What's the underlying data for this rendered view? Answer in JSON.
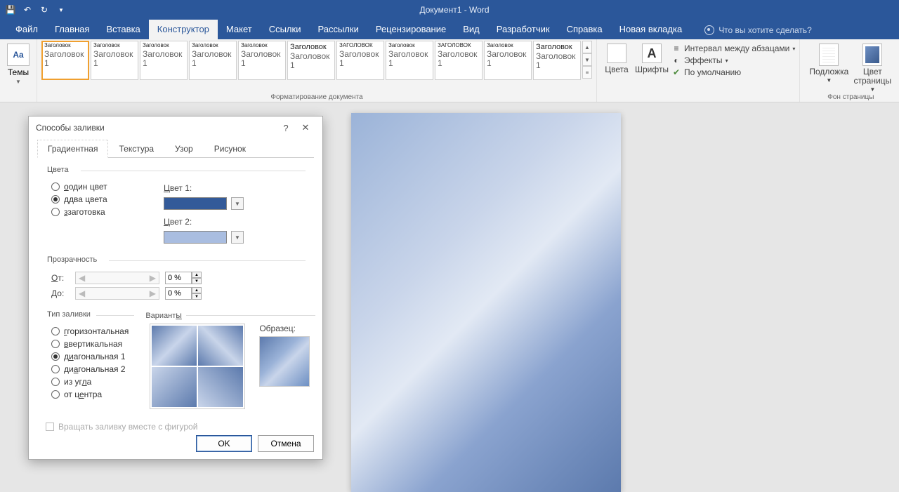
{
  "titlebar": {
    "document_title": "Документ1 - Word"
  },
  "tabs": {
    "file": "Файл",
    "home": "Главная",
    "insert": "Вставка",
    "design": "Конструктор",
    "layout": "Макет",
    "references": "Ссылки",
    "mailings": "Рассылки",
    "review": "Рецензирование",
    "view": "Вид",
    "developer": "Разработчик",
    "help": "Справка",
    "new_tab": "Новая вкладка",
    "tell_me": "Что вы хотите сделать?"
  },
  "ribbon": {
    "themes": "Темы",
    "doc_formatting_label": "Форматирование документа",
    "style_heading_variants": [
      "Заголовок",
      "Заголовок",
      "Заголовок",
      "Заголовок",
      "Заголовок",
      "Заголовок",
      "ЗАГОЛОВОК",
      "Заголовок",
      "ЗАГОЛОВОК",
      "Заголовок",
      "Заголовок"
    ],
    "style_sub": "Заголовок 1",
    "colors": "Цвета",
    "fonts": "Шрифты",
    "para_spacing": "Интервал между абзацами",
    "effects": "Эффекты",
    "set_default": "По умолчанию",
    "watermark": "Подложка",
    "page_color": "Цвет страницы",
    "page_bg_label": "Фон страницы"
  },
  "dialog": {
    "title": "Способы заливки",
    "tabs": {
      "gradient": "Градиентная",
      "texture": "Текстура",
      "pattern": "Узор",
      "picture": "Рисунок"
    },
    "colors_legend": "Цвета",
    "one_color": "один цвет",
    "two_colors": "два цвета",
    "preset": "заготовка",
    "color1_label": "Цвет 1:",
    "color2_label": "Цвет 2:",
    "color1_value": "#335a99",
    "color2_value": "#a9bde0",
    "transparency_legend": "Прозрачность",
    "from_label": "От:",
    "to_label": "До:",
    "from_value": "0 %",
    "to_value": "0 %",
    "fill_type_legend": "Тип заливки",
    "horizontal": "горизонтальная",
    "vertical": "вертикальная",
    "diag1": "диагональная 1",
    "diag2": "диагональная 2",
    "from_corner": "из угла",
    "from_center": "от центра",
    "variants_legend": "Варианты",
    "sample_label": "Образец:",
    "rotate_with_shape": "Вращать заливку вместе с фигурой",
    "ok": "OK",
    "cancel": "Отмена"
  }
}
